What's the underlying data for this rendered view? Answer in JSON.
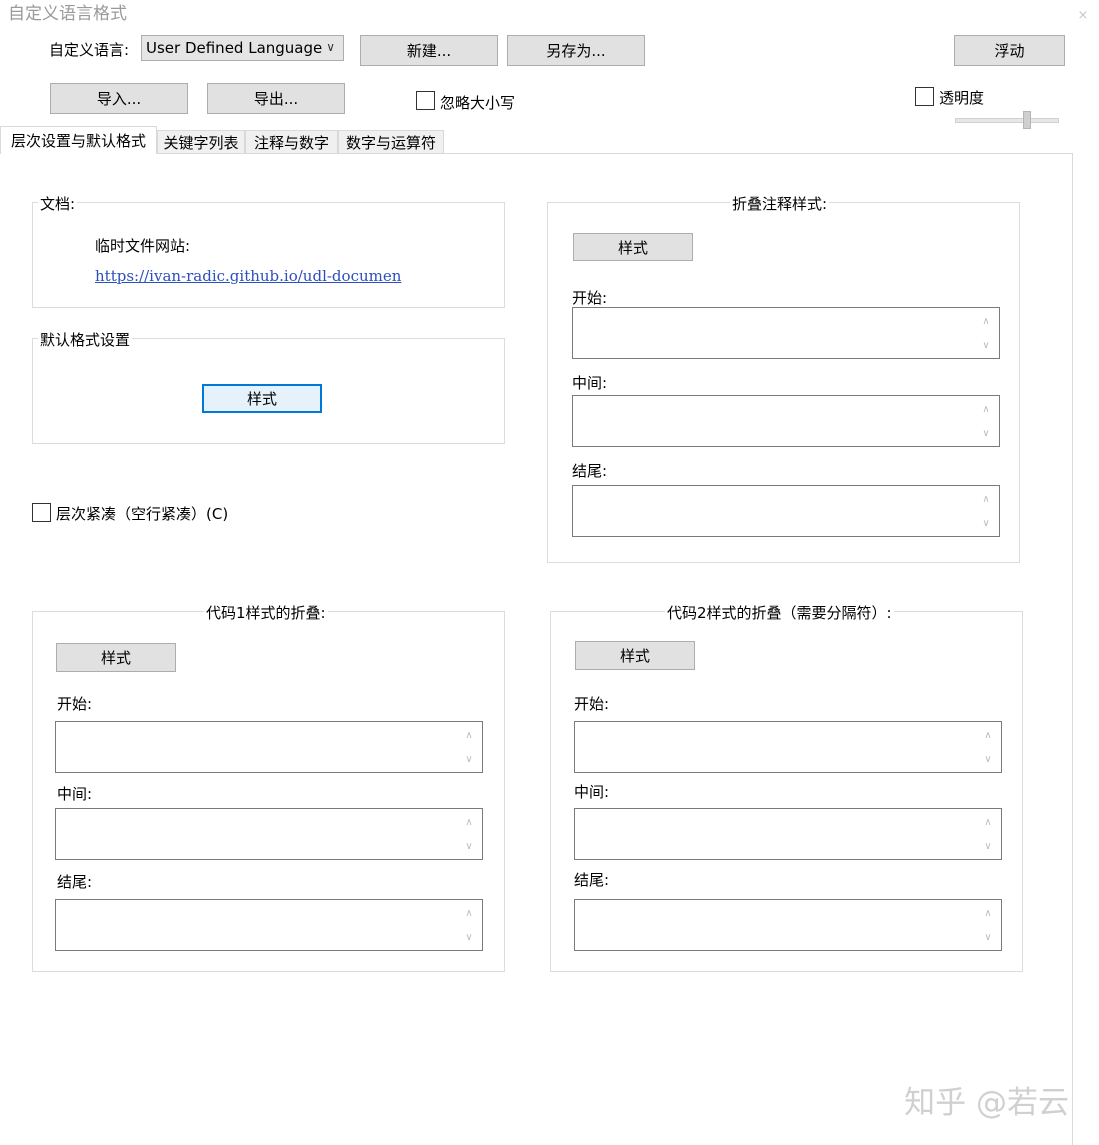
{
  "window": {
    "title": "自定义语言格式",
    "close_glyph": "×"
  },
  "toolbar": {
    "language_label": "自定义语言:",
    "language_value": "User Defined Language",
    "new_button": "新建...",
    "save_as_button": "另存为...",
    "dock_button": "浮动",
    "import_button": "导入...",
    "export_button": "导出...",
    "ignore_case_label": "忽略大小写",
    "ignore_case_checked": false,
    "transparency_label": "透明度",
    "transparency_checked": false
  },
  "tabs": [
    {
      "label": "层次设置与默认格式",
      "active": true
    },
    {
      "label": "关键字列表",
      "active": false
    },
    {
      "label": "注释与数字",
      "active": false
    },
    {
      "label": "数字与运算符",
      "active": false
    }
  ],
  "documentation": {
    "legend": "文档:",
    "temp_site_label": "临时文件网站:",
    "link_text": "https://ivan-radic.github.io/udl-documen"
  },
  "default_style": {
    "legend": "默认格式设置",
    "style_button": "样式"
  },
  "compact": {
    "label": "层次紧凑（空行紧凑）(C)",
    "checked": false
  },
  "fold_comment": {
    "legend": "折叠注释样式:",
    "style_button": "样式",
    "open_label": "开始:",
    "middle_label": "中间:",
    "close_label": "结尾:"
  },
  "fold_code1": {
    "legend": "代码1样式的折叠:",
    "style_button": "样式",
    "open_label": "开始:",
    "middle_label": "中间:",
    "close_label": "结尾:"
  },
  "fold_code2": {
    "legend": "代码2样式的折叠（需要分隔符）:",
    "style_button": "样式",
    "open_label": "开始:",
    "middle_label": "中间:",
    "close_label": "结尾:"
  },
  "watermark": "知乎 @若云",
  "icons": {
    "combo_arrow": "chevron-down-icon",
    "scroll_up": "chevron-up-icon",
    "scroll_down": "chevron-down-icon"
  }
}
